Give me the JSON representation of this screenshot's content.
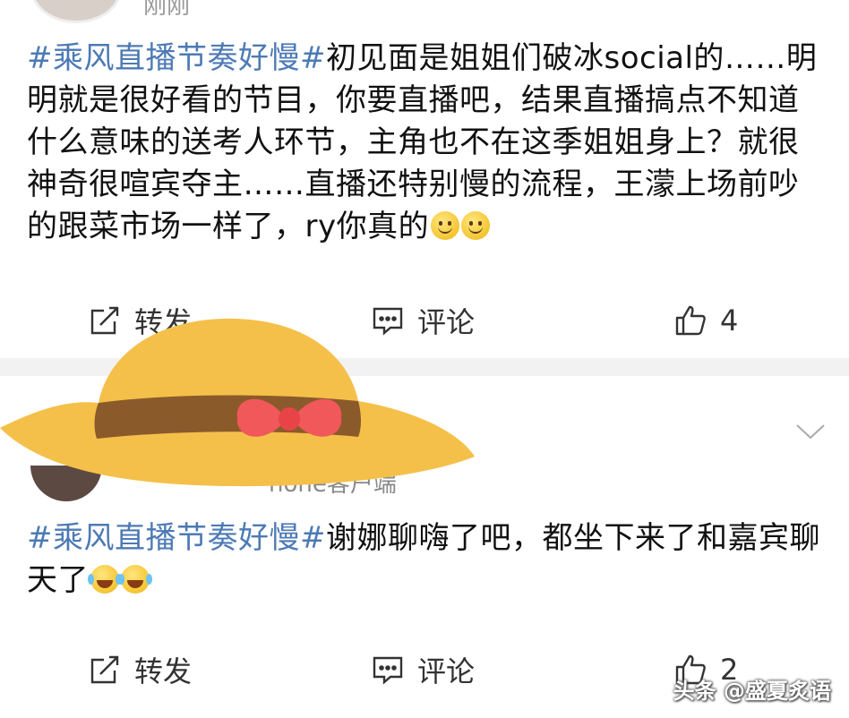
{
  "post1": {
    "time": "刚刚",
    "hashtag": "#乘风直播节奏好慢#",
    "text": "初见面是姐姐们破冰social的……明明就是很好看的节目，你要直播吧，结果直播搞点不知道什么意味的送考人环节，主角也不在这季姐姐身上？就很神奇很喧宾夺主……直播还特别慢的流程，王濛上场前吵的跟菜市场一样了，ry你真的",
    "emojis": [
      "smile-emoji",
      "smile-emoji"
    ],
    "actions": {
      "repost": "转发",
      "comment": "评论",
      "like_count": "4"
    }
  },
  "post2": {
    "source": "hone客户端",
    "hashtag": "#乘风直播节奏好慢#",
    "text": "谢娜聊嗨了吧，都坐下来了和嘉宾聊天了",
    "emojis": [
      "laugh-cry-emoji",
      "laugh-cry-emoji"
    ],
    "actions": {
      "repost": "转发",
      "comment": "评论",
      "like_count": "2"
    }
  },
  "watermark": "头条 @盛夏炙语",
  "colors": {
    "hashtag": "#4d7ab5",
    "hat": "#f5c04a",
    "hat_band": "#8b5a2b",
    "bow": "#f0585a",
    "divider": "#f2f2f2"
  }
}
